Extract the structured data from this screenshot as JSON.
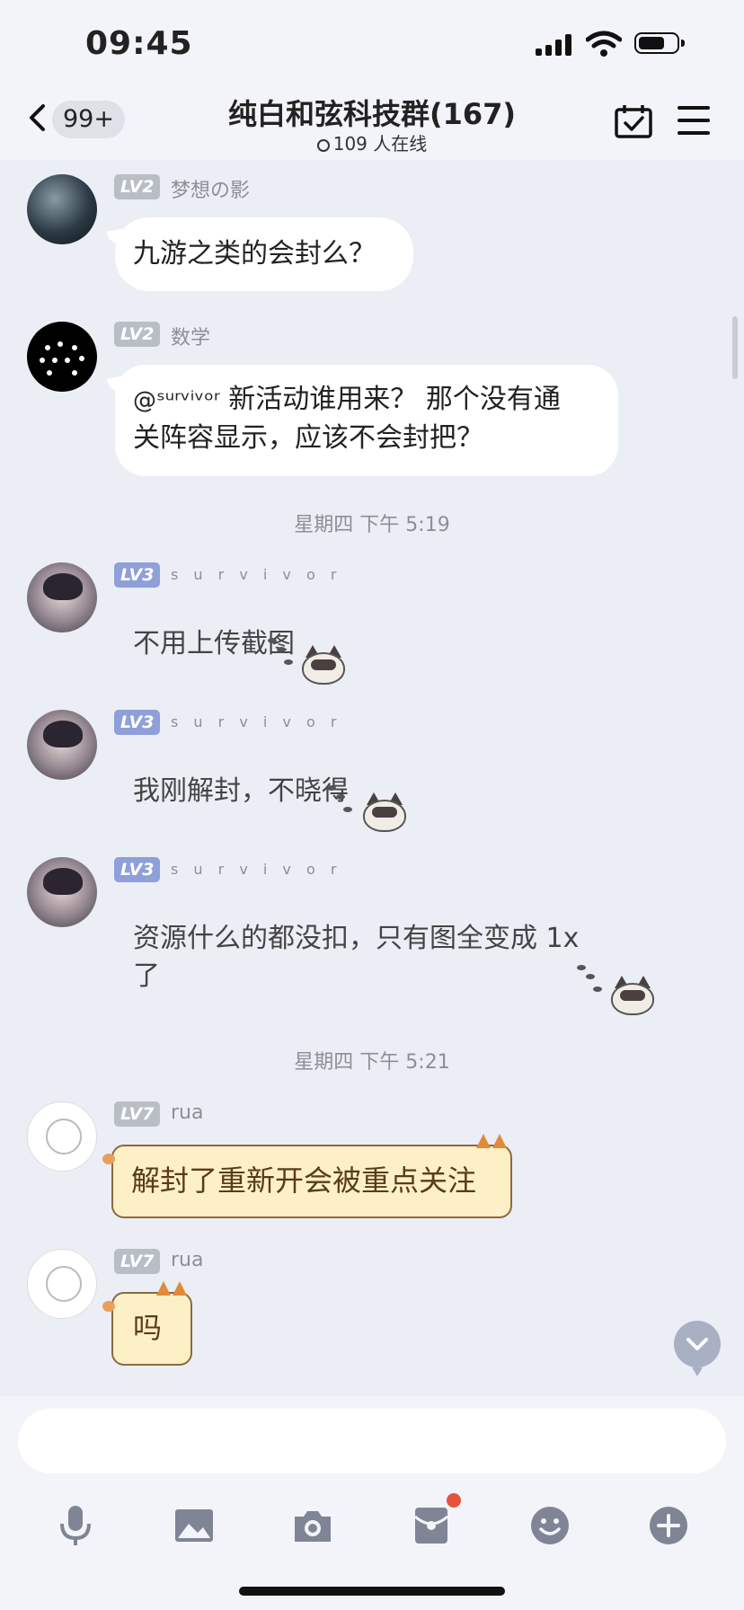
{
  "status_bar": {
    "time": "09:45"
  },
  "header": {
    "back_badge": "99+",
    "title": "纯白和弦科技群(167)",
    "online": "109 人在线"
  },
  "messages": [
    {
      "level": "LV2",
      "nick": "梦想の影",
      "text": "九游之类的会封么？"
    },
    {
      "level": "LV2",
      "nick": "数学",
      "mention": "@ˢᵘʳᵛⁱᵛᵒʳ",
      "text_line1": " 新活动谁用来？ 那个没有通",
      "text_line2": "关阵容显示，应该不会封把？"
    },
    {
      "timestamp": "星期四 下午 5:19"
    },
    {
      "level": "LV3",
      "nick": "s u r v i v o r",
      "text": "不用上传截图"
    },
    {
      "level": "LV3",
      "nick": "s u r v i v o r",
      "text": "我刚解封，不晓得"
    },
    {
      "level": "LV3",
      "nick": "s u r v i v o r",
      "text_line1": "资源什么的都没扣，只有图全变成 1x",
      "text_line2": "了"
    },
    {
      "timestamp": "星期四 下午 5:21"
    },
    {
      "level": "LV7",
      "nick": "rua",
      "text": "解封了重新开会被重点关注"
    },
    {
      "level": "LV7",
      "nick": "rua",
      "text": "吗"
    }
  ]
}
